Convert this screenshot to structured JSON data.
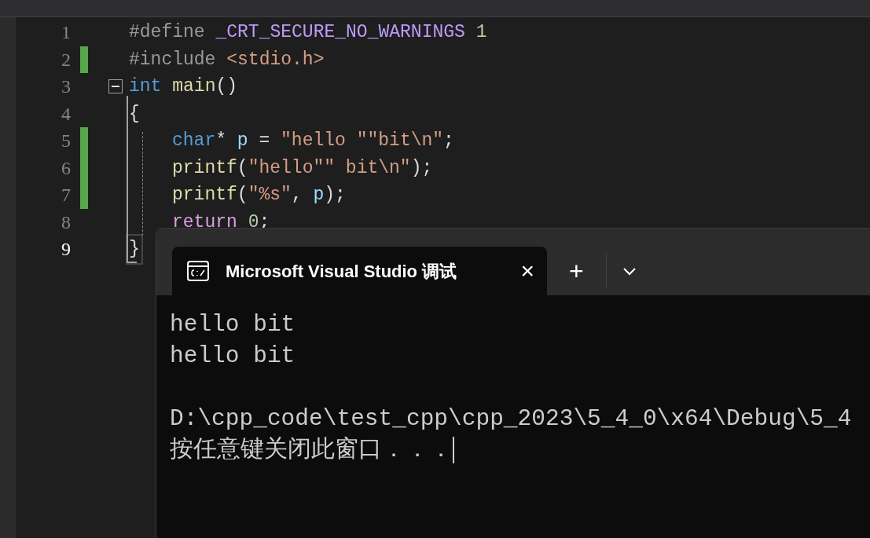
{
  "editor": {
    "lines": [
      {
        "number": "1",
        "changed": false,
        "current": false,
        "indented": false,
        "tokens": [
          {
            "kind": "preproc",
            "text": "#define "
          },
          {
            "kind": "macro",
            "text": "_CRT_SECURE_NO_WARNINGS"
          },
          {
            "kind": "number",
            "text": " 1"
          }
        ]
      },
      {
        "number": "2",
        "changed": true,
        "current": false,
        "indented": false,
        "tokens": [
          {
            "kind": "preproc",
            "text": "#include "
          },
          {
            "kind": "string",
            "text": "<stdio.h>"
          }
        ]
      },
      {
        "number": "3",
        "changed": false,
        "current": false,
        "indented": false,
        "expanded": true,
        "tokens": [
          {
            "kind": "keyword",
            "text": "int"
          },
          {
            "kind": "function",
            "text": " main"
          },
          {
            "kind": "plain",
            "text": "()"
          }
        ]
      },
      {
        "number": "4",
        "changed": false,
        "current": false,
        "indented": false,
        "tokens": [
          {
            "kind": "plain",
            "text": "{"
          }
        ]
      },
      {
        "number": "5",
        "changed": true,
        "current": false,
        "indented": true,
        "tokens": [
          {
            "kind": "keyword",
            "text": "char"
          },
          {
            "kind": "plain",
            "text": "* "
          },
          {
            "kind": "variable",
            "text": "p"
          },
          {
            "kind": "plain",
            "text": " = "
          },
          {
            "kind": "string",
            "text": "\"hello \"\"bit\\n\""
          },
          {
            "kind": "plain",
            "text": ";"
          }
        ]
      },
      {
        "number": "6",
        "changed": true,
        "current": false,
        "indented": true,
        "tokens": [
          {
            "kind": "function",
            "text": "printf"
          },
          {
            "kind": "plain",
            "text": "("
          },
          {
            "kind": "string",
            "text": "\"hello\"\" bit\\n\""
          },
          {
            "kind": "plain",
            "text": ");"
          }
        ]
      },
      {
        "number": "7",
        "changed": true,
        "current": false,
        "indented": true,
        "tokens": [
          {
            "kind": "function",
            "text": "printf"
          },
          {
            "kind": "plain",
            "text": "("
          },
          {
            "kind": "string",
            "text": "\"%s\""
          },
          {
            "kind": "plain",
            "text": ", "
          },
          {
            "kind": "variable",
            "text": "p"
          },
          {
            "kind": "plain",
            "text": ");"
          }
        ]
      },
      {
        "number": "8",
        "changed": false,
        "current": false,
        "indented": true,
        "tokens": [
          {
            "kind": "control",
            "text": "return"
          },
          {
            "kind": "number",
            "text": " 0"
          },
          {
            "kind": "plain",
            "text": ";"
          }
        ]
      },
      {
        "number": "9",
        "changed": false,
        "current": true,
        "indented": false,
        "tokens": [
          {
            "kind": "plain",
            "text": "}"
          }
        ]
      }
    ]
  },
  "terminal": {
    "tab": {
      "title": "Microsoft Visual Studio 调试",
      "close": "×"
    },
    "new_tab": "+",
    "program_output": [
      "hello bit",
      "hello bit"
    ],
    "exit_message": [
      "D:\\cpp_code\\test_cpp\\cpp_2023\\5_4_0\\x64\\Debug\\5_4",
      "按任意键关闭此窗口．．．"
    ],
    "cursor_visible": true
  }
}
